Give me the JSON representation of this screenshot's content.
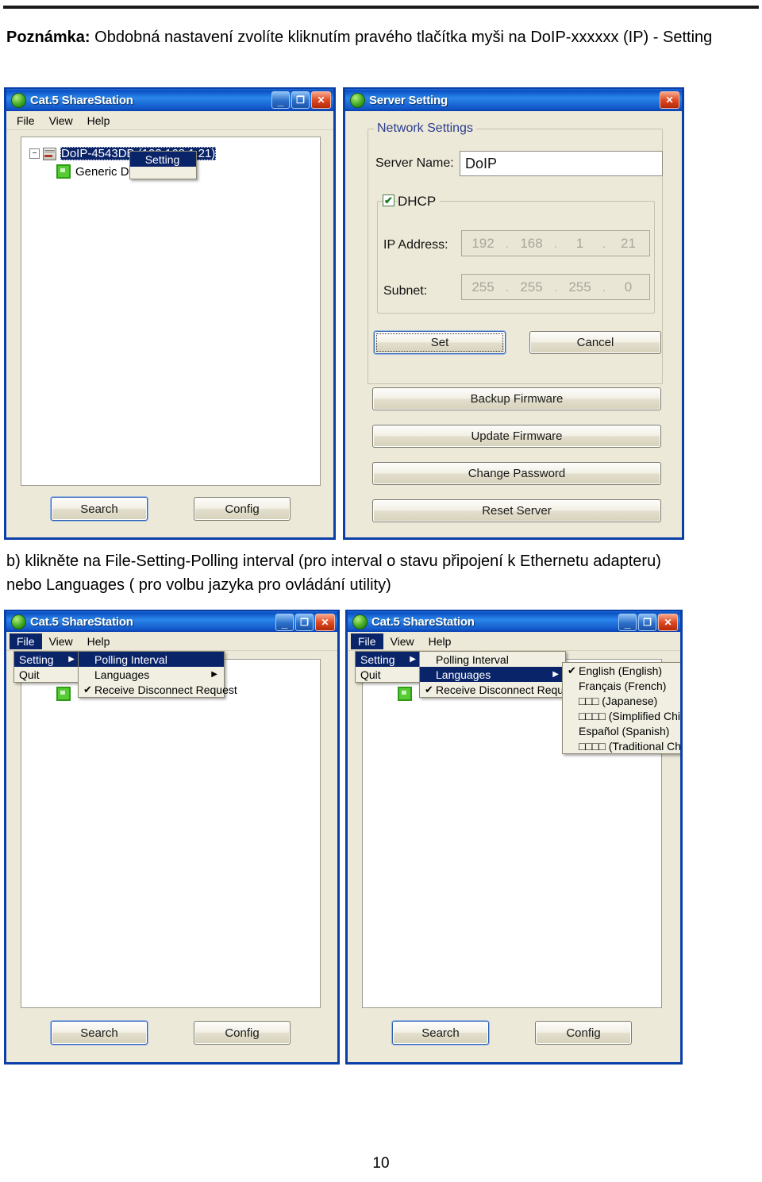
{
  "page": {
    "note_prefix": "Poznámka:",
    "note_text": " Obdobná nastavení zvolíte kliknutím pravého tlačítka myši na DoIP-xxxxxx (IP) - Setting",
    "paragraph_b_line1": "b) klikněte na File-Setting-Polling interval (pro interval o stavu připojení k Ethernetu adapteru)",
    "paragraph_b_line2": "nebo Languages ( pro volbu jazyka pro ovládání utility)",
    "page_number": "10",
    "colors": {
      "title_bar_blue": "#0b4fc3",
      "window_border": "#0b3fa8",
      "dialog_face": "#ece9d8",
      "menu_highlight": "#0a246a",
      "group_label": "#2a3c8f",
      "close_red": "#e04a23"
    }
  },
  "window_sharestation_top": {
    "title": "Cat.5 ShareStation",
    "menus": [
      "File",
      "View",
      "Help"
    ],
    "tree": {
      "node_device": "DoIP-4543DB (192.168.1.21)",
      "node_child": "Generic D",
      "expander": "−"
    },
    "context_menu": {
      "items": [
        "Setting"
      ]
    },
    "buttons": {
      "search": "Search",
      "config": "Config"
    },
    "titlebar_buttons": {
      "minimize": "_",
      "maximize": "❐",
      "close": "✕"
    }
  },
  "window_server_setting": {
    "title": "Server Setting",
    "group_network": "Network Settings",
    "server_name_label": "Server Name:",
    "server_name_value": "DoIP",
    "dhcp_label": "DHCP",
    "dhcp_checked": "✔",
    "ip_label": "IP Address:",
    "ip_octets": [
      "192",
      "168",
      "1",
      "21"
    ],
    "subnet_label": "Subnet:",
    "subnet_octets": [
      "255",
      "255",
      "255",
      "0"
    ],
    "buttons": {
      "set": "Set",
      "cancel": "Cancel",
      "backup_firmware": "Backup Firmware",
      "update_firmware": "Update Firmware",
      "change_password": "Change Password",
      "reset_server": "Reset Server"
    },
    "titlebar_buttons": {
      "close": "✕"
    }
  },
  "window_sharestation_bottom_left": {
    "title": "Cat.5 ShareStation",
    "menus": [
      "File",
      "View",
      "Help"
    ],
    "file_menu": [
      {
        "label": "Setting",
        "arrow": "▶",
        "highlighted": true
      },
      {
        "label": "Quit",
        "arrow": "",
        "highlighted": false
      }
    ],
    "setting_submenu": [
      {
        "label": "Polling Interval",
        "check": "",
        "arrow": "",
        "highlighted": true
      },
      {
        "label": "Languages",
        "check": "",
        "arrow": "▶",
        "highlighted": false
      },
      {
        "label": "Receive Disconnect Request",
        "check": "✔",
        "arrow": "",
        "highlighted": false
      }
    ],
    "buttons": {
      "search": "Search",
      "config": "Config"
    },
    "titlebar_buttons": {
      "minimize": "_",
      "maximize": "❐",
      "close": "✕"
    }
  },
  "window_sharestation_bottom_right": {
    "title": "Cat.5 ShareStation",
    "menus": [
      "File",
      "View",
      "Help"
    ],
    "file_menu": [
      {
        "label": "Setting",
        "arrow": "▶",
        "highlighted": true
      },
      {
        "label": "Quit",
        "arrow": "",
        "highlighted": false
      }
    ],
    "setting_submenu": [
      {
        "label": "Polling Interval",
        "check": "",
        "arrow": "",
        "highlighted": false
      },
      {
        "label": "Languages",
        "check": "",
        "arrow": "▶",
        "highlighted": true
      },
      {
        "label": "Receive Disconnect Request",
        "check": "✔",
        "arrow": "",
        "highlighted": false
      }
    ],
    "languages_submenu": [
      {
        "label": "English (English)",
        "check": "✔"
      },
      {
        "label": "Français (French)",
        "check": ""
      },
      {
        "label": "□□□ (Japanese)",
        "check": ""
      },
      {
        "label": "□□□□ (Simplified Chinese)",
        "check": ""
      },
      {
        "label": "Español (Spanish)",
        "check": ""
      },
      {
        "label": "□□□□ (Traditional Chinese)",
        "check": ""
      }
    ],
    "buttons": {
      "search": "Search",
      "config": "Config"
    },
    "titlebar_buttons": {
      "minimize": "_",
      "maximize": "❐",
      "close": "✕"
    }
  }
}
